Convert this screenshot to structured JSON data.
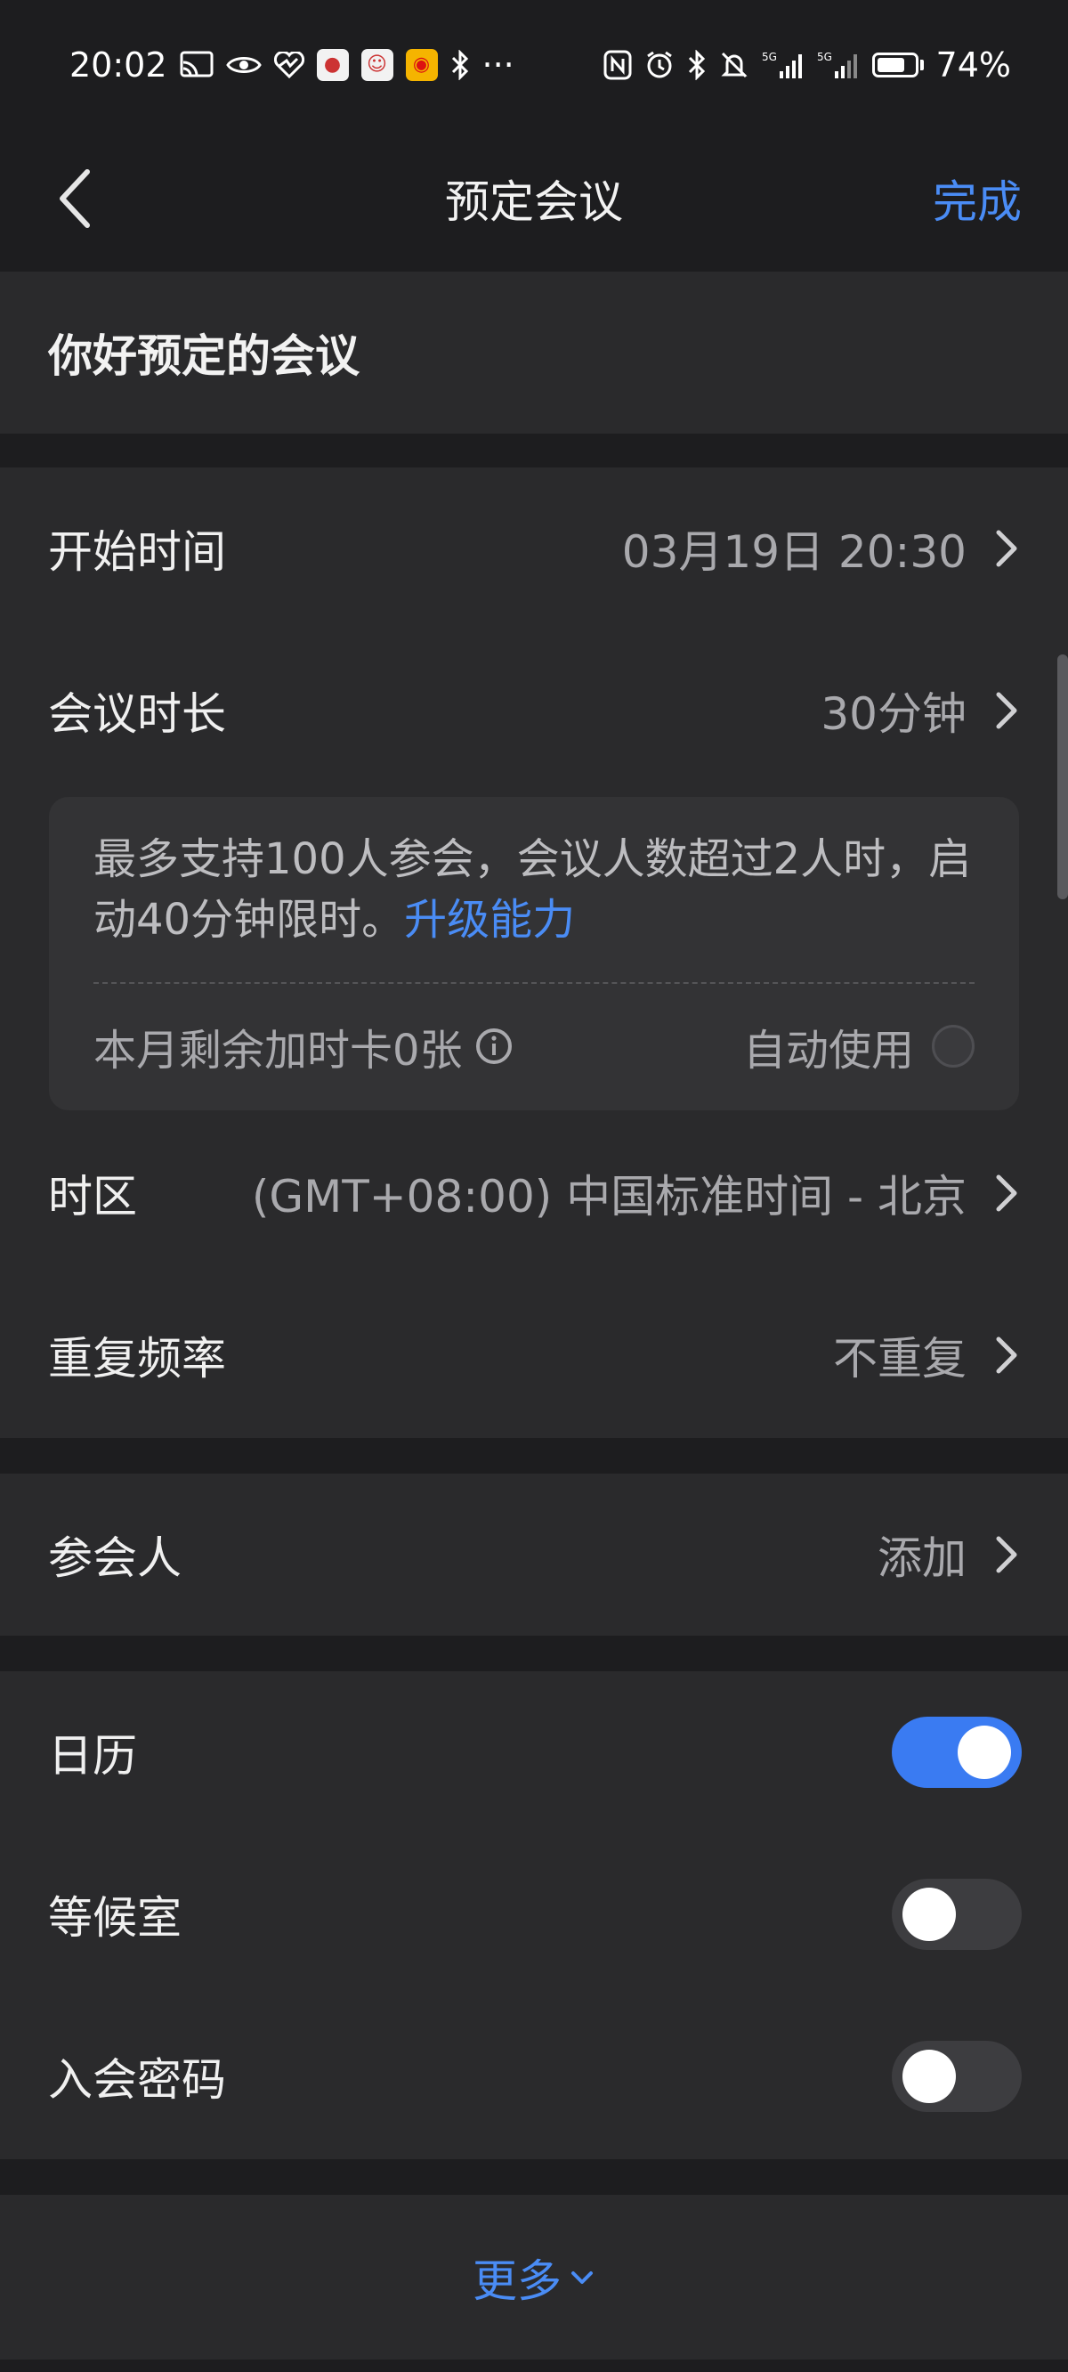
{
  "status_bar": {
    "time": "20:02",
    "network": "5G",
    "battery_percent": "74%",
    "battery_level": 0.74,
    "more": "···"
  },
  "nav": {
    "title": "预定会议",
    "done_label": "完成"
  },
  "meeting": {
    "topic": "你好预定的会议"
  },
  "schedule": {
    "start_label": "开始时间",
    "start_value": "03月19日 20:30",
    "duration_label": "会议时长",
    "duration_value": "30分钟",
    "info_text": "最多支持100人参会，会议人数超过2人时，启动40分钟限时。",
    "upgrade_link": "升级能力",
    "card_label": "本月剩余加时卡0张",
    "auto_use_label": "自动使用",
    "timezone_label": "时区",
    "timezone_value": "(GMT+08:00) 中国标准时间 - 北京",
    "repeat_label": "重复频率",
    "repeat_value": "不重复"
  },
  "participants": {
    "label": "参会人",
    "value": "添加"
  },
  "options": {
    "calendar_label": "日历",
    "calendar_on": true,
    "waiting_room_label": "等候室",
    "waiting_room_on": false,
    "password_label": "入会密码",
    "password_on": false
  },
  "more_label": "更多",
  "colors": {
    "accent": "#4a8cf5",
    "toggle_on": "#3a7bf2",
    "background": "#1d1d1f",
    "section": "#2a2a2c"
  }
}
